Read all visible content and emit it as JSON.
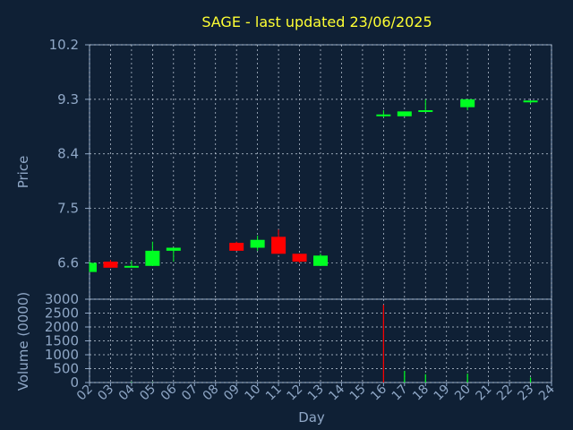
{
  "chart_data": [
    {
      "type": "candlestick",
      "title": "SAGE - last updated 23/06/2025",
      "ylabel": "Price",
      "ylim": [
        6.0,
        10.2
      ],
      "yticks": [
        "10.2",
        "9.3",
        "8.4",
        "7.5",
        "6.6"
      ],
      "grid": true,
      "colors": {
        "up": "#00ff22",
        "down": "#ff0000"
      },
      "x_categories": [
        "02",
        "03",
        "04",
        "05",
        "06",
        "07",
        "08",
        "09",
        "10",
        "11",
        "12",
        "13",
        "14",
        "15",
        "16",
        "17",
        "18",
        "19",
        "20",
        "21",
        "22",
        "23",
        "24"
      ],
      "candles": [
        {
          "day": "02",
          "open": 6.45,
          "high": 6.62,
          "low": 6.45,
          "close": 6.6
        },
        {
          "day": "03",
          "open": 6.62,
          "high": 6.65,
          "low": 6.52,
          "close": 6.52
        },
        {
          "day": "04",
          "open": 6.53,
          "high": 6.63,
          "low": 6.53,
          "close": 6.55
        },
        {
          "day": "05",
          "open": 6.55,
          "high": 6.95,
          "low": 6.55,
          "close": 6.8
        },
        {
          "day": "06",
          "open": 6.8,
          "high": 6.85,
          "low": 6.62,
          "close": 6.85
        },
        {
          "day": "09",
          "open": 6.93,
          "high": 6.95,
          "low": 6.8,
          "close": 6.8
        },
        {
          "day": "10",
          "open": 6.85,
          "high": 7.05,
          "low": 6.8,
          "close": 6.98
        },
        {
          "day": "11",
          "open": 7.03,
          "high": 7.15,
          "low": 6.75,
          "close": 6.75
        },
        {
          "day": "12",
          "open": 6.75,
          "high": 6.75,
          "low": 6.6,
          "close": 6.62
        },
        {
          "day": "13",
          "open": 6.55,
          "high": 6.75,
          "low": 6.55,
          "close": 6.72
        },
        {
          "day": "16",
          "open": 9.05,
          "high": 9.12,
          "low": 9.0,
          "close": 9.05
        },
        {
          "day": "17",
          "open": 9.02,
          "high": 9.1,
          "low": 9.02,
          "close": 9.1
        },
        {
          "day": "18",
          "open": 9.1,
          "high": 9.3,
          "low": 9.1,
          "close": 9.12
        },
        {
          "day": "20",
          "open": 9.17,
          "high": 9.3,
          "low": 9.12,
          "close": 9.3
        },
        {
          "day": "23",
          "open": 9.25,
          "high": 9.28,
          "low": 9.23,
          "close": 9.28
        }
      ]
    },
    {
      "type": "bar",
      "xlabel": "Day",
      "ylabel": "Volume (0000)",
      "ylim": [
        0,
        3000
      ],
      "yticks": [
        "3000",
        "2500",
        "2000",
        "1500",
        "1000",
        "500",
        "0"
      ],
      "grid": true,
      "categories": [
        "02",
        "03",
        "04",
        "05",
        "06",
        "07",
        "08",
        "09",
        "10",
        "11",
        "12",
        "13",
        "14",
        "15",
        "16",
        "17",
        "18",
        "19",
        "20",
        "21",
        "22",
        "23",
        "24"
      ],
      "bars": [
        {
          "day": "04",
          "value": 20,
          "direction": "up"
        },
        {
          "day": "05",
          "value": 10,
          "direction": "up"
        },
        {
          "day": "16",
          "value": 2800,
          "direction": "down"
        },
        {
          "day": "17",
          "value": 420,
          "direction": "up"
        },
        {
          "day": "18",
          "value": 300,
          "direction": "up"
        },
        {
          "day": "20",
          "value": 320,
          "direction": "up"
        },
        {
          "day": "23",
          "value": 180,
          "direction": "up"
        }
      ]
    }
  ]
}
